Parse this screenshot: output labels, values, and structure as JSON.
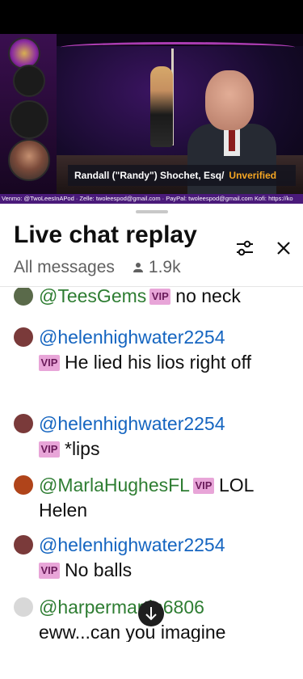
{
  "video": {
    "lower_third_name": "Randall (\"Randy\") Shochet, Esq/",
    "lower_third_status": "Unverified",
    "ticker": "Venmo: @TwoLeesInAPod · Zelle: twoleespod@gmail.com · PayPal: twoleespod@gmail.com Kofi: https://ko"
  },
  "chat": {
    "title": "Live chat replay",
    "filter": "All messages",
    "viewers": "1.9k",
    "vip_label": "VIP",
    "messages": [
      {
        "author": "@TeesGems",
        "text": "no neck",
        "author_color": "#2e7d32",
        "avatar_color": "#5a6a4a"
      },
      {
        "author": "@helenhighwater2254",
        "text": "He lied his lios right off",
        "author_color": "#1565c0",
        "avatar_color": "#7a3a3a"
      },
      {
        "author": "@helenhighwater2254",
        "text": "*lips",
        "author_color": "#1565c0",
        "avatar_color": "#7a3a3a"
      },
      {
        "author": "@MarlaHughesFL",
        "text": "LOL Helen",
        "author_color": "#2e7d32",
        "avatar_color": "#b0441a"
      },
      {
        "author": "@helenhighwater2254",
        "text": "No balls",
        "author_color": "#1565c0",
        "avatar_color": "#7a3a3a"
      },
      {
        "author": "@harpermartin6806",
        "text": "eww...can you imagine",
        "author_color": "#2e7d32",
        "avatar_color": "#d8d8d8"
      }
    ]
  },
  "icons": {
    "tune": "tune-icon",
    "close": "close-icon",
    "viewers": "person-icon",
    "scroll_down": "arrow-down-icon"
  }
}
